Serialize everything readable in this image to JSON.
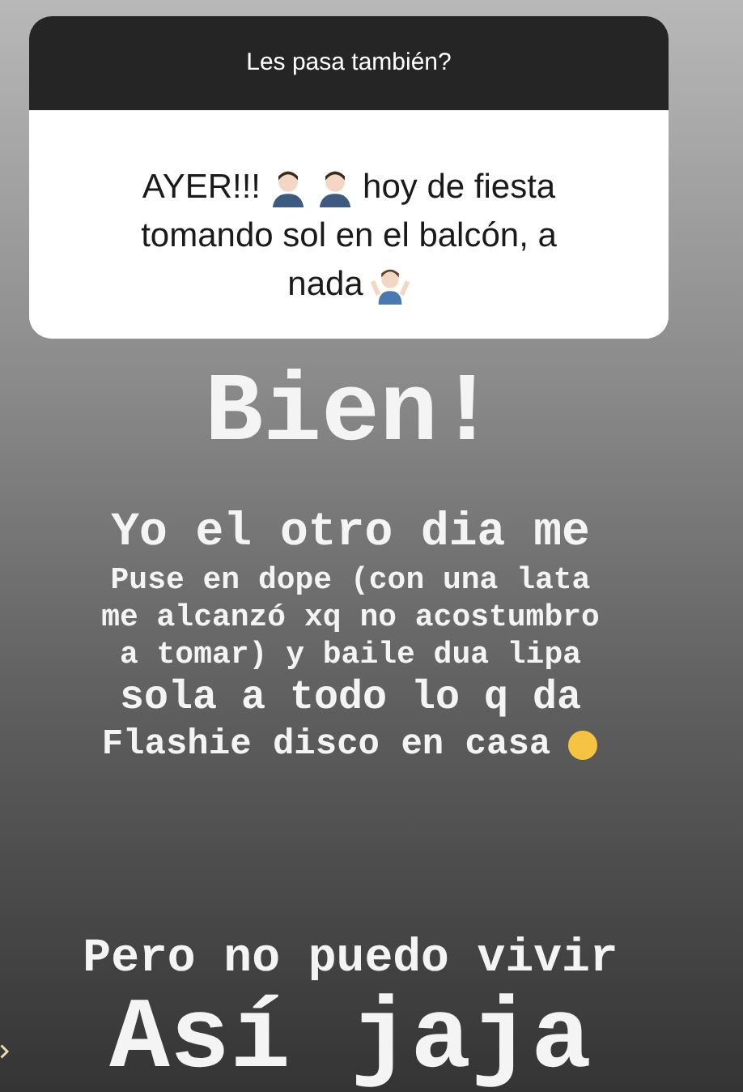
{
  "question_card": {
    "question": "Les pasa también?",
    "answer_lines": [
      {
        "segments": [
          {
            "kind": "text",
            "text": "AYER!!!"
          },
          {
            "kind": "person"
          },
          {
            "kind": "person"
          },
          {
            "kind": "text",
            "text": "hoy de fiesta"
          }
        ]
      },
      {
        "segments": [
          {
            "kind": "text",
            "text": "tomando sol en el balcón, a"
          }
        ]
      },
      {
        "segments": [
          {
            "kind": "text",
            "text": "nada"
          },
          {
            "kind": "shrug"
          }
        ]
      }
    ]
  },
  "story_groups": [
    {
      "lines": [
        {
          "kind": "huge",
          "segments": [
            {
              "kind": "text",
              "text": "Bien!"
            }
          ]
        }
      ]
    },
    {
      "lines": [
        {
          "kind": "large",
          "segments": [
            {
              "kind": "text",
              "text": "Yo el otro dia me"
            }
          ]
        },
        {
          "kind": "small",
          "segments": [
            {
              "kind": "text",
              "text": "Puse en dope (con una lata"
            }
          ]
        },
        {
          "kind": "small",
          "segments": [
            {
              "kind": "text",
              "text": "me alcanzó xq no acostumbro"
            }
          ]
        },
        {
          "kind": "small",
          "segments": [
            {
              "kind": "text",
              "text": "a tomar) y baile dua lipa"
            }
          ]
        },
        {
          "kind": "medium",
          "segments": [
            {
              "kind": "text",
              "text": "sola a todo lo q da"
            }
          ]
        },
        {
          "kind": "normal",
          "segments": [
            {
              "kind": "text",
              "text": "Flashie disco en casa"
            },
            {
              "kind": "face"
            }
          ]
        }
      ]
    },
    {
      "lines": [
        {
          "kind": "large",
          "segments": [
            {
              "kind": "text",
              "text": "Pero no puedo vivir"
            }
          ]
        },
        {
          "kind": "huge2",
          "segments": [
            {
              "kind": "text",
              "text": "Así jaja"
            }
          ]
        }
      ]
    }
  ]
}
